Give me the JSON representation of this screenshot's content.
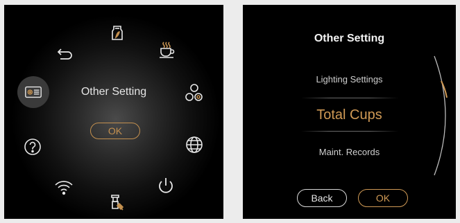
{
  "left_screen": {
    "title": "Other Setting",
    "ok_label": "OK",
    "icons": [
      "milk-jug-icon",
      "coffee-cup-icon",
      "brew-group-icon",
      "globe-icon",
      "power-icon",
      "cleaning-icon",
      "wifi-icon",
      "help-icon",
      "settings-icon",
      "back-arrow-icon"
    ],
    "accent_color": "#c4904f"
  },
  "right_screen": {
    "title": "Other Setting",
    "menu_items": [
      "Lighting Settings",
      "Total Cups",
      "Maint. Records"
    ],
    "selected_item": "Total Cups",
    "back_label": "Back",
    "ok_label": "OK",
    "accent_color": "#d09a55"
  }
}
